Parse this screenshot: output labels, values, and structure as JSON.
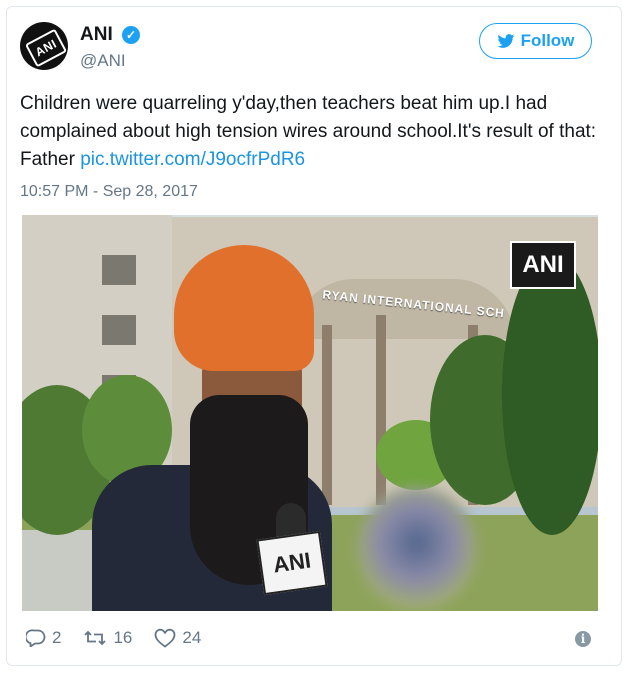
{
  "account": {
    "name": "ANI",
    "handle": "@ANI",
    "avatar_text": "ANI",
    "avatar_icon": "ani-logo",
    "verified_icon": "verified-badge-icon"
  },
  "follow": {
    "label": "Follow",
    "icon": "twitter-bird-icon"
  },
  "tweet": {
    "text": "Children were quarreling y'day,then teachers beat him up.I had complained about high tension wires around school.It's result of that: Father ",
    "link": "pic.twitter.com/J9ocfrPdR6",
    "timestamp": "10:57 PM - Sep 28, 2017"
  },
  "media": {
    "watermark": "ANI",
    "building_sign": "RYAN INTERNATIONAL SCH",
    "mic_flag": "ANI"
  },
  "actions": {
    "reply_count": "2",
    "retweet_count": "16",
    "like_count": "24"
  },
  "colors": {
    "accent": "#1da1f2",
    "link": "#1b95e0",
    "muted": "#657786"
  }
}
